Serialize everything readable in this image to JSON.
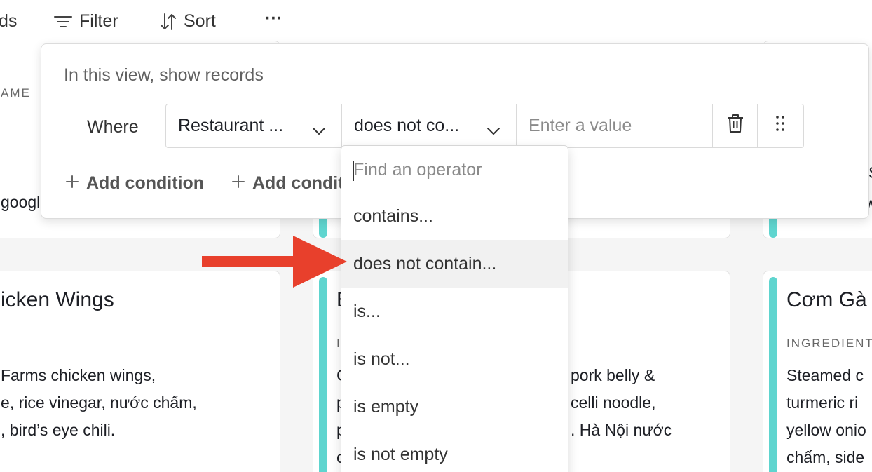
{
  "toolbar": {
    "fields_label_fragment": "ds",
    "filter_label": "Filter",
    "sort_label": "Sort",
    "more_label": "···"
  },
  "cards": {
    "top_left_label": "AME",
    "top_left_text": "googl",
    "left_card": {
      "title": "icken Wings",
      "lines": [
        " Farms chicken wings,",
        "e, rice vinegar, nước chấm,",
        ", bird’s eye chili."
      ]
    },
    "middle_card": {
      "title": "B",
      "label": "I",
      "lines_left": [
        "C",
        "p",
        "p",
        "c"
      ],
      "lines_right": [
        "pork belly &",
        "celli noodle,",
        ". Hà Nội nước"
      ]
    },
    "right_card": {
      "title": "Cơm Gà",
      "label": "INGREDIENT",
      "lines": [
        "Steamed c",
        "turmeric ri",
        "yellow onio",
        "chấm, side"
      ]
    },
    "right_top_fragment": "S",
    "right_top_fragment2": "w"
  },
  "filter_popup": {
    "title": "In this view, show records",
    "where_label": "Where",
    "field_value": "Restaurant ...",
    "operator_value": "does not co...",
    "value_placeholder": "Enter a value",
    "add_condition_label": "Add condition",
    "add_condition_group_label": "Add condit"
  },
  "operator_dropdown": {
    "search_placeholder": "Find an operator",
    "options": [
      "contains...",
      "does not contain...",
      "is...",
      "is not...",
      "is empty",
      "is not empty"
    ],
    "highlighted": "does not contain..."
  },
  "colors": {
    "accent_stripe": "#5fd5cf",
    "annotation_arrow": "#e8402c",
    "highlight_row": "#f1f1f1"
  },
  "icons": [
    "filter-icon",
    "sort-icon",
    "more-icon",
    "chevron-down-icon",
    "trash-icon",
    "drag-handle-icon",
    "plus-icon",
    "annotation-arrow"
  ]
}
